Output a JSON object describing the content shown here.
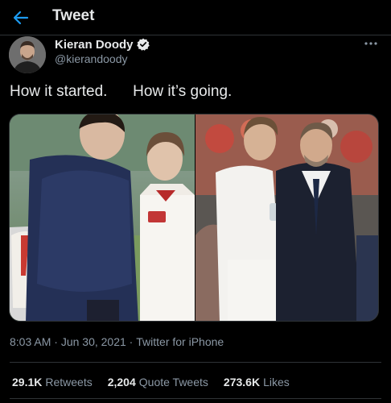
{
  "header": {
    "title": "Tweet",
    "back_icon": "arrow-left-icon",
    "accent": "#1d9bf0"
  },
  "author": {
    "name": "Kieran Doody",
    "handle": "@kierandoody",
    "verified": true
  },
  "tweet": {
    "text": "How it started.      How it’s going."
  },
  "media": {
    "left_image": "football-drama-scene-photo",
    "right_image": "england-football-players-photo"
  },
  "meta": {
    "time": "8:03 AM",
    "separator": " · ",
    "date": "Jun 30, 2021",
    "source": "Twitter for iPhone"
  },
  "stats": {
    "retweets_count": "29.1K",
    "retweets_label": "Retweets",
    "quotes_count": "2,204",
    "quotes_label": "Quote Tweets",
    "likes_count": "273.6K",
    "likes_label": "Likes"
  },
  "colors": {
    "background": "#000000",
    "text": "#e7e9ea",
    "secondary_text": "#8b98a5",
    "divider": "#2f3336"
  }
}
